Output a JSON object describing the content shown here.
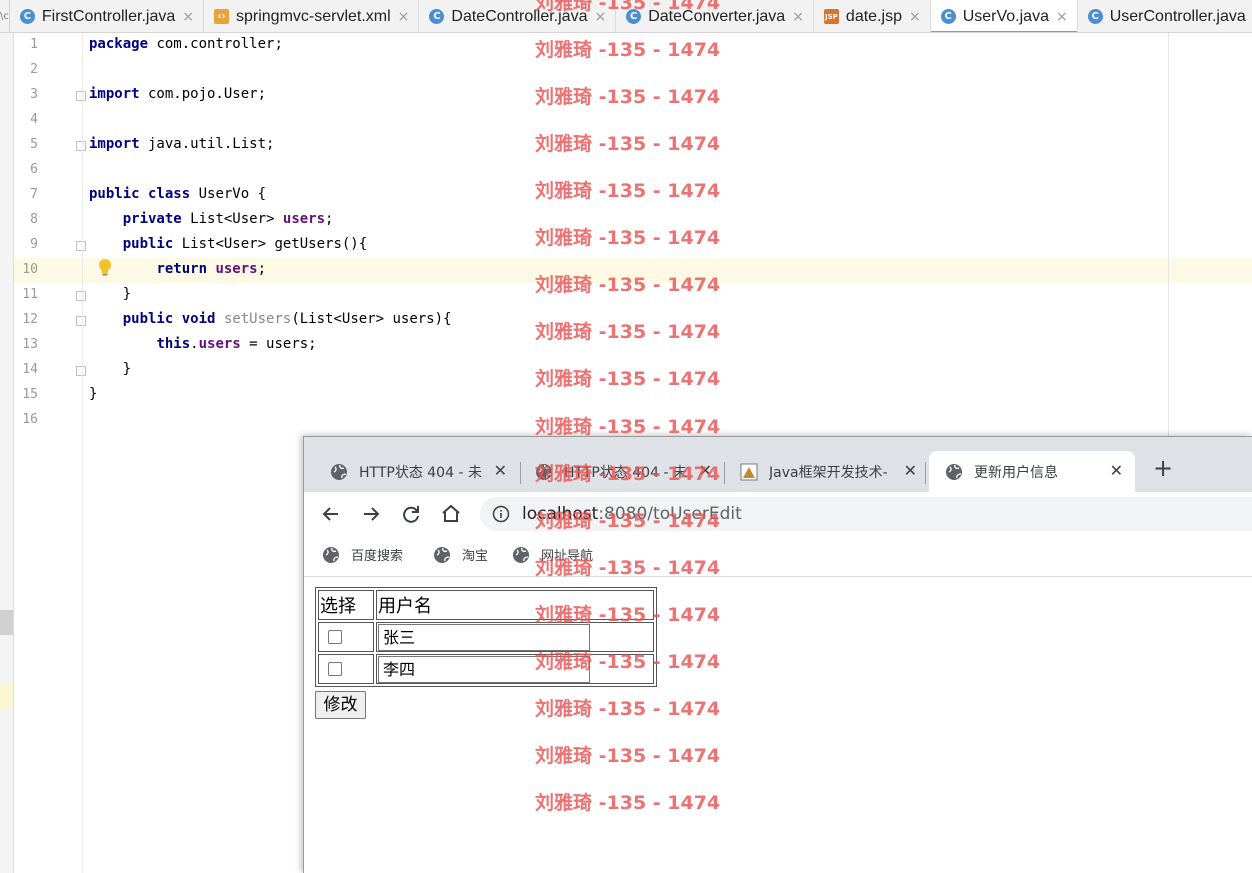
{
  "ide": {
    "tabs": [
      {
        "label": "FirstController.java",
        "type": "java"
      },
      {
        "label": "springmvc-servlet.xml",
        "type": "xml"
      },
      {
        "label": "DateController.java",
        "type": "java"
      },
      {
        "label": "DateConverter.java",
        "type": "java"
      },
      {
        "label": "date.jsp",
        "type": "jsp"
      },
      {
        "label": "UserVo.java",
        "type": "java",
        "active": true
      },
      {
        "label": "UserController.java",
        "type": "java"
      }
    ],
    "left_stub": "\\c",
    "current_line": 10,
    "code_lines": [
      {
        "n": "1",
        "tokens": [
          [
            "kw",
            "package"
          ],
          [
            "t",
            " com.controller;"
          ]
        ]
      },
      {
        "n": "2",
        "tokens": []
      },
      {
        "n": "3",
        "tokens": [
          [
            "kw",
            "import"
          ],
          [
            "t",
            " com.pojo.User;"
          ]
        ]
      },
      {
        "n": "4",
        "tokens": []
      },
      {
        "n": "5",
        "tokens": [
          [
            "kw",
            "import"
          ],
          [
            "t",
            " java.util.List;"
          ]
        ]
      },
      {
        "n": "6",
        "tokens": []
      },
      {
        "n": "7",
        "tokens": [
          [
            "kw",
            "public class"
          ],
          [
            "t",
            " UserVo {"
          ]
        ]
      },
      {
        "n": "8",
        "tokens": [
          [
            "t",
            "    "
          ],
          [
            "kw",
            "private"
          ],
          [
            "t",
            " List<User> "
          ],
          [
            "fld",
            "users"
          ],
          [
            "t",
            ";"
          ]
        ]
      },
      {
        "n": "9",
        "tokens": [
          [
            "t",
            "    "
          ],
          [
            "kw",
            "public"
          ],
          [
            "t",
            " List<User> getUsers(){"
          ]
        ]
      },
      {
        "n": "10",
        "tokens": [
          [
            "t",
            "        "
          ],
          [
            "kw",
            "return"
          ],
          [
            "t",
            " "
          ],
          [
            "fld",
            "users"
          ],
          [
            "t",
            ";"
          ]
        ]
      },
      {
        "n": "11",
        "tokens": [
          [
            "t",
            "    }"
          ]
        ]
      },
      {
        "n": "12",
        "tokens": [
          [
            "t",
            "    "
          ],
          [
            "kw",
            "public void"
          ],
          [
            "t",
            " "
          ],
          [
            "unused",
            "setUsers"
          ],
          [
            "t",
            "(List<User> users){"
          ]
        ]
      },
      {
        "n": "13",
        "tokens": [
          [
            "t",
            "        "
          ],
          [
            "kw",
            "this"
          ],
          [
            "t",
            "."
          ],
          [
            "fld",
            "users"
          ],
          [
            "t",
            " = users;"
          ]
        ]
      },
      {
        "n": "14",
        "tokens": [
          [
            "t",
            "    }"
          ]
        ]
      },
      {
        "n": "15",
        "tokens": [
          [
            "t",
            "}"
          ]
        ]
      },
      {
        "n": "16",
        "tokens": []
      }
    ]
  },
  "browser": {
    "tabs": [
      {
        "title": "HTTP状态 404 - 未",
        "active": false
      },
      {
        "title": "HTTP状态 404 - 未",
        "active": false
      },
      {
        "title": "Java框架开发技术-",
        "active": false
      },
      {
        "title": "更新用户信息",
        "active": true
      }
    ],
    "close_glyph": "✕",
    "new_tab_glyph": "+",
    "url_host": "localhost",
    "url_path": ":8080/toUserEdit",
    "bookmarks": [
      "百度搜索",
      "淘宝",
      "网址导航"
    ],
    "table": {
      "headers": [
        "选择",
        "用户名"
      ],
      "rows": [
        {
          "checked": false,
          "username": "张三"
        },
        {
          "checked": false,
          "username": "李四"
        }
      ]
    },
    "submit_label": "修改"
  },
  "watermark": {
    "text": "刘雅琦 -135 - 1474",
    "color": "#e85454",
    "repeat_count": 18
  },
  "colors": {
    "keyword": "#000080",
    "field": "#660e7a",
    "current_line_bg": "#fcfae4",
    "chrome_tabbar": "#dee1e6"
  }
}
